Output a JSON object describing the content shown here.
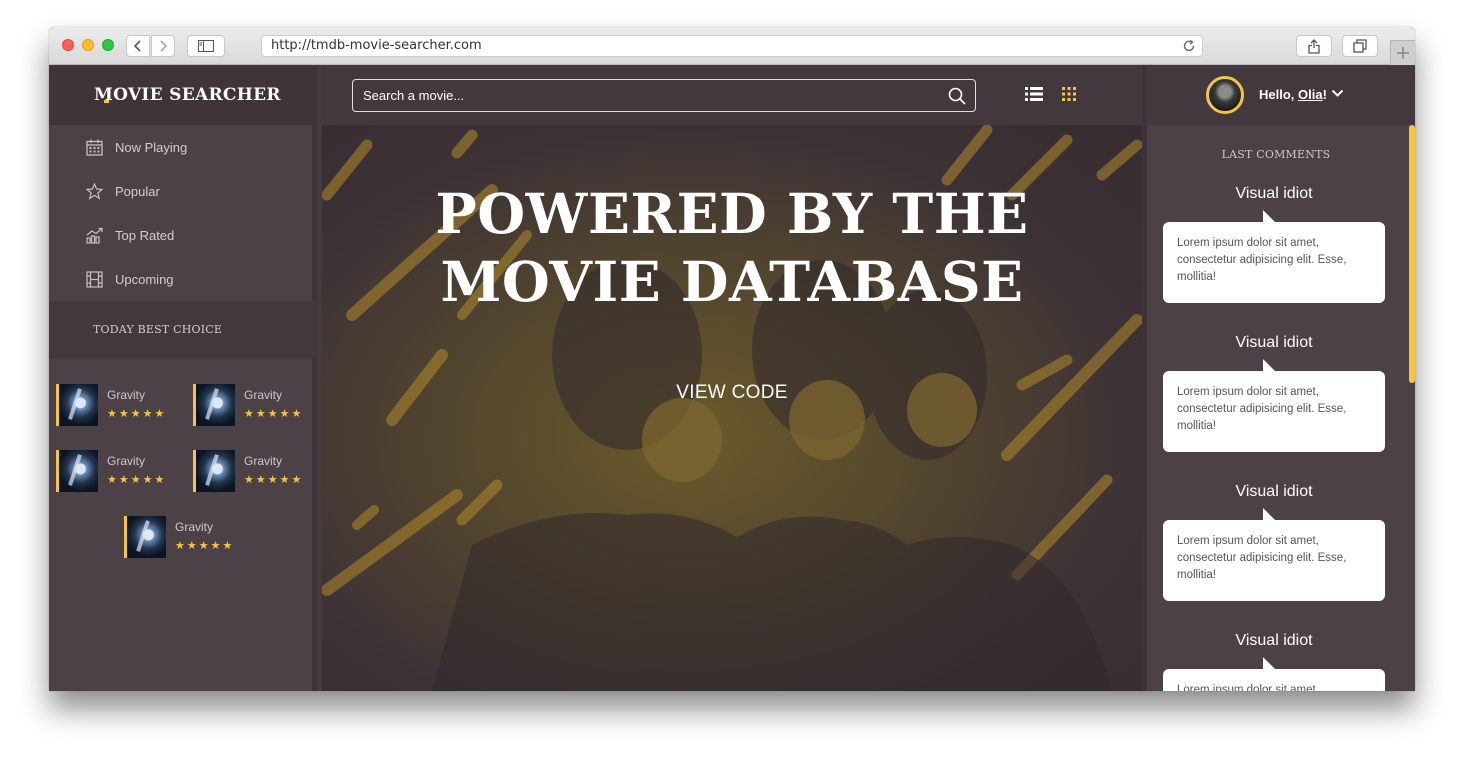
{
  "browser": {
    "url": "http://tmdb-movie-searcher.com"
  },
  "app": {
    "logo": "MOVIE SEARCHER"
  },
  "sidebar": {
    "items": [
      {
        "label": "Now Playing",
        "icon": "calendar-icon"
      },
      {
        "label": "Popular",
        "icon": "star-icon"
      },
      {
        "label": "Top Rated",
        "icon": "chart-icon"
      },
      {
        "label": "Upcoming",
        "icon": "film-icon"
      }
    ],
    "best_title": "TODAY BEST CHOICE",
    "best": [
      {
        "title": "Gravity",
        "stars": "★★★★★"
      },
      {
        "title": "Gravity",
        "stars": "★★★★★"
      },
      {
        "title": "Gravity",
        "stars": "★★★★★"
      },
      {
        "title": "Gravity",
        "stars": "★★★★★"
      },
      {
        "title": "Gravity",
        "stars": "★★★★★"
      }
    ]
  },
  "search": {
    "placeholder": "Search a movie..."
  },
  "hero": {
    "title": "POWERED BY THE MOVIE DATABASE",
    "button": "VIEW CODE"
  },
  "user": {
    "greeting": "Hello, ",
    "name": "Olia",
    "suffix": "!"
  },
  "comments": {
    "title": "LAST COMMENTS",
    "items": [
      {
        "author": "Visual idiot",
        "text": "Lorem ipsum dolor sit amet, consectetur adipisicing elit. Esse, mollitia!"
      },
      {
        "author": "Visual idiot",
        "text": "Lorem ipsum dolor sit amet, consectetur adipisicing elit. Esse, mollitia!"
      },
      {
        "author": "Visual idiot",
        "text": "Lorem ipsum dolor sit amet, consectetur adipisicing elit. Esse, mollitia!"
      },
      {
        "author": "Visual idiot",
        "text": "Lorem ipsum dolor sit amet, consectetur adipisicing elit. Esse, mollitia!"
      }
    ]
  },
  "colors": {
    "accent": "#f5c542",
    "panel": "#4b4147",
    "bar": "#43383d"
  }
}
